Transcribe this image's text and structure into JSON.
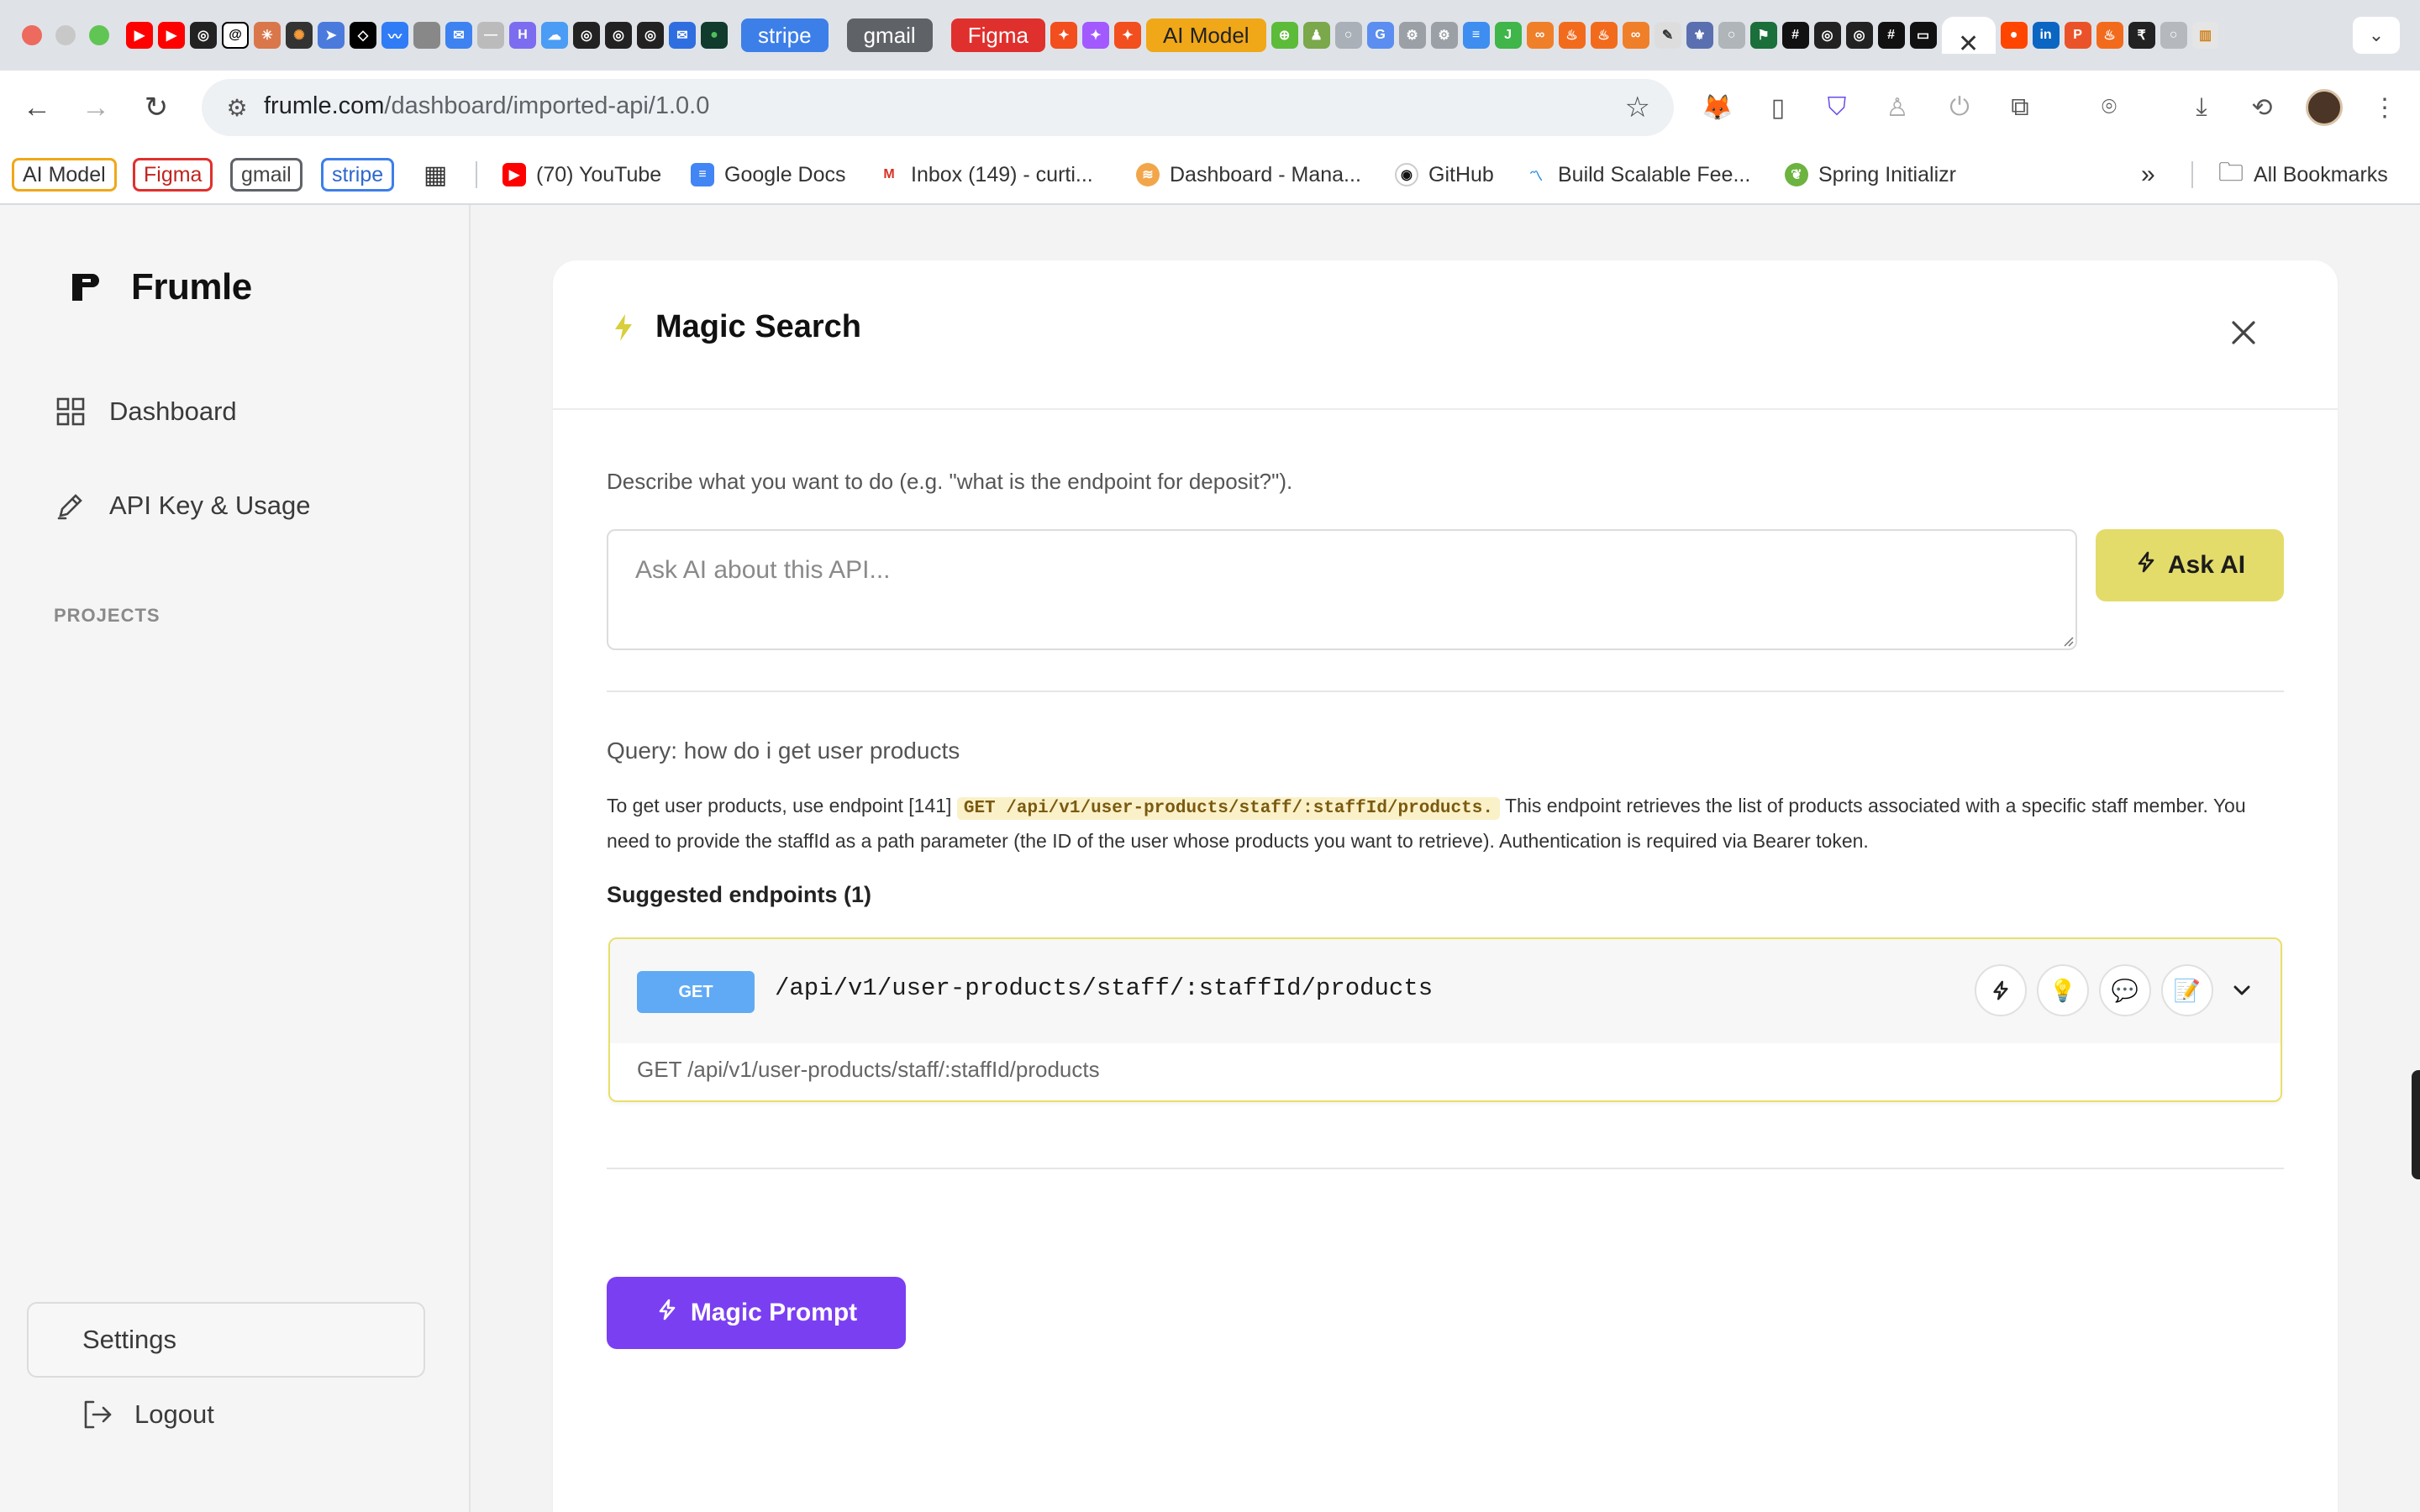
{
  "browser": {
    "tab_pills": [
      "stripe",
      "gmail",
      "Figma",
      "AI Model"
    ],
    "url_host": "frumle.com",
    "url_path": "/dashboard/imported-api/1.0.0",
    "bookmarks": {
      "pills": [
        "AI Model",
        "Figma",
        "gmail",
        "stripe"
      ],
      "links": [
        "(70) YouTube",
        "Google Docs",
        "Inbox (149) - curti...",
        "Dashboard - Mana...",
        "GitHub",
        "Build Scalable Fee...",
        "Spring Initializr"
      ],
      "overflow": "»",
      "all_bookmarks": "All Bookmarks"
    }
  },
  "sidebar": {
    "brand": "Frumle",
    "nav": [
      {
        "label": "Dashboard",
        "icon": "grid-icon"
      },
      {
        "label": "API Key & Usage",
        "icon": "key-pen-icon"
      }
    ],
    "projects_label": "PROJECTS",
    "settings_label": "Settings",
    "logout_label": "Logout"
  },
  "magic_search": {
    "title": "Magic Search",
    "describe": "Describe what you want to do (e.g. \"what is the endpoint for deposit?\").",
    "input_placeholder": "Ask AI about this API...",
    "input_value": "",
    "ask_button": "Ask AI",
    "query_text": "Query: how do i get user products",
    "answer_pre": "To get user products, use endpoint [141]",
    "answer_code": "GET /api/v1/user-products/staff/:staffId/products.",
    "answer_post": "This endpoint retrieves the list of products associated with a specific staff member. You need to provide the staffId as a path parameter (the ID of the user whose products you want to retrieve). Authentication is required via Bearer token.",
    "suggested_heading": "Suggested endpoints (1)",
    "endpoints": [
      {
        "method": "GET",
        "path": "/api/v1/user-products/staff/:staffId/products",
        "description": "GET /api/v1/user-products/staff/:staffId/products"
      }
    ],
    "magic_prompt_button": "Magic Prompt"
  },
  "colors": {
    "accent_yellow": "#e3dc6b",
    "accent_purple": "#7b3ff2",
    "method_get": "#60aaf5"
  }
}
